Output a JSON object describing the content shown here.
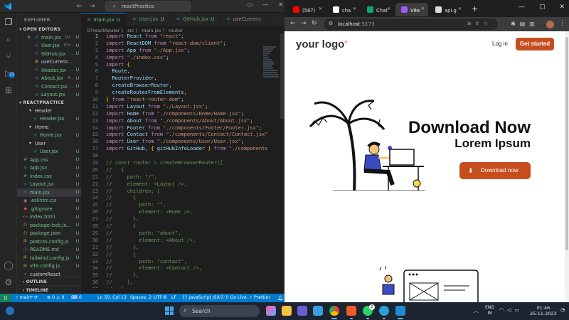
{
  "vscode": {
    "title_search": "reactPractice",
    "nav_back": "←",
    "nav_forward": "→",
    "explorer_label": "EXPLORER",
    "open_editors_label": "OPEN EDITORS",
    "open_editors": [
      {
        "icon": "×",
        "name": "main.jsx",
        "path": "07...",
        "status": "U"
      },
      {
        "icon": "",
        "name": "User.jsx",
        "path": "07r...",
        "status": "U"
      },
      {
        "icon": "",
        "name": "GitHub.jsx",
        "path": "...",
        "status": "U"
      },
      {
        "icon": "",
        "name": "useCurrencyInfo.j...",
        "path": "",
        "status": ""
      },
      {
        "icon": "",
        "name": "Header.jsx",
        "path": "...",
        "status": "U"
      },
      {
        "icon": "",
        "name": "About.jsx",
        "path": "0...",
        "status": "U"
      },
      {
        "icon": "",
        "name": "Contact.jsx",
        "path": "...",
        "status": "U"
      },
      {
        "icon": "",
        "name": "Layout.jsx",
        "path": "...",
        "status": "U"
      }
    ],
    "project_label": "REACTPRACTICE",
    "tree": [
      {
        "name": "Header",
        "kind": "folder",
        "indent": 2,
        "status": ""
      },
      {
        "name": "Header.jsx",
        "kind": "react",
        "indent": 3,
        "status": "U"
      },
      {
        "name": "Home",
        "kind": "folder",
        "indent": 2,
        "status": ""
      },
      {
        "name": "Home.jsx",
        "kind": "react",
        "indent": 3,
        "status": "U"
      },
      {
        "name": "User",
        "kind": "folder",
        "indent": 2,
        "status": ""
      },
      {
        "name": "User.jsx",
        "kind": "react",
        "indent": 3,
        "status": "U"
      },
      {
        "name": "App.css",
        "kind": "css",
        "indent": 1,
        "status": "U"
      },
      {
        "name": "App.jsx",
        "kind": "react",
        "indent": 1,
        "status": "U"
      },
      {
        "name": "index.css",
        "kind": "css",
        "indent": 1,
        "status": "U"
      },
      {
        "name": "Layout.jsx",
        "kind": "react",
        "indent": 1,
        "status": "U"
      },
      {
        "name": "main.jsx",
        "kind": "react",
        "indent": 1,
        "status": "U",
        "selected": true
      },
      {
        "name": ".eslintrc.cjs",
        "kind": "eslint",
        "indent": 1,
        "status": "U"
      },
      {
        "name": ".gitignore",
        "kind": "git",
        "indent": 1,
        "status": "U"
      },
      {
        "name": "index.html",
        "kind": "html",
        "indent": 1,
        "status": "U"
      },
      {
        "name": "package-lock.js...",
        "kind": "json",
        "indent": 1,
        "status": "U"
      },
      {
        "name": "package.json",
        "kind": "json",
        "indent": 1,
        "status": "U"
      },
      {
        "name": "postcss.config.js",
        "kind": "js",
        "indent": 1,
        "status": "U"
      },
      {
        "name": "README.md",
        "kind": "md",
        "indent": 1,
        "status": "U"
      },
      {
        "name": "tailwind.config.js",
        "kind": "js",
        "indent": 1,
        "status": "U"
      },
      {
        "name": "vite.config.js",
        "kind": "js",
        "indent": 1,
        "status": "U"
      },
      {
        "name": "customReact",
        "kind": "folder-closed",
        "indent": 1,
        "status": ""
      }
    ],
    "outline_label": "OUTLINE",
    "timeline_label": "TIMELINE",
    "activity_badge": "21",
    "tabs": [
      {
        "label": "main.jsx",
        "status": "U",
        "active": true
      },
      {
        "label": "User.jsx",
        "status": "U",
        "active": false
      },
      {
        "label": "GitHub.jsx",
        "status": "U",
        "active": false
      },
      {
        "label": "useCurrenc",
        "status": "",
        "active": false
      }
    ],
    "breadcrumb": "07reactRouter 〉 src 〉 main.jsx 〉 router",
    "code_lines": [
      [
        [
          "k",
          "import "
        ],
        [
          "v",
          "React "
        ],
        [
          "k",
          "from "
        ],
        [
          "s",
          "\"react\""
        ],
        [
          "",
          "; "
        ]
      ],
      [
        [
          "k",
          "import "
        ],
        [
          "v",
          "ReactDOM "
        ],
        [
          "k",
          "from "
        ],
        [
          "s",
          "\"react-dom/client\""
        ],
        [
          "",
          ";"
        ]
      ],
      [
        [
          "k",
          "import "
        ],
        [
          "v",
          "App "
        ],
        [
          "k",
          "from "
        ],
        [
          "s",
          "\"./App.jsx\""
        ],
        [
          "",
          ";"
        ]
      ],
      [
        [
          "k",
          "import "
        ],
        [
          "s",
          "\"./index.css\""
        ],
        [
          "",
          ";"
        ]
      ],
      [
        [
          "k",
          "import "
        ],
        [
          "p",
          "{"
        ]
      ],
      [
        [
          "",
          "  "
        ],
        [
          "v",
          "Route"
        ],
        [
          "",
          ","
        ]
      ],
      [
        [
          "",
          "  "
        ],
        [
          "v",
          "RouterProvider"
        ],
        [
          "",
          ","
        ]
      ],
      [
        [
          "",
          "  "
        ],
        [
          "v",
          "createBrowserRouter"
        ],
        [
          "",
          ","
        ]
      ],
      [
        [
          "",
          "  "
        ],
        [
          "v",
          "createRoutesFromElements"
        ],
        [
          "",
          ","
        ]
      ],
      [
        [
          "p",
          "} "
        ],
        [
          "k",
          "from "
        ],
        [
          "s",
          "\"react-router-dom\""
        ],
        [
          "",
          ";"
        ]
      ],
      [
        [
          "k",
          "import "
        ],
        [
          "v",
          "Layout "
        ],
        [
          "k",
          "from "
        ],
        [
          "s",
          "\"./Layout.jsx\""
        ],
        [
          "",
          ";"
        ]
      ],
      [
        [
          "k",
          "import "
        ],
        [
          "v",
          "Home "
        ],
        [
          "k",
          "from "
        ],
        [
          "s",
          "\"./components/Home/Home.jsx\""
        ],
        [
          "",
          ";"
        ]
      ],
      [
        [
          "k",
          "import "
        ],
        [
          "v",
          "About "
        ],
        [
          "k",
          "from "
        ],
        [
          "s",
          "\"./components/About/About.jsx\""
        ],
        [
          "",
          ";"
        ]
      ],
      [
        [
          "k",
          "import "
        ],
        [
          "v",
          "Footer "
        ],
        [
          "k",
          "from "
        ],
        [
          "s",
          "\"./components/Footer/Footer.jsx\""
        ],
        [
          "",
          ";"
        ]
      ],
      [
        [
          "k",
          "import "
        ],
        [
          "v",
          "Contact "
        ],
        [
          "k",
          "from "
        ],
        [
          "s",
          "\"./components/Contact/Contact.jsx\""
        ]
      ],
      [
        [
          "k",
          "import "
        ],
        [
          "v",
          "User "
        ],
        [
          "k",
          "from "
        ],
        [
          "s",
          "\"./components/User/User.jsx\""
        ],
        [
          "",
          ";"
        ]
      ],
      [
        [
          "k",
          "import "
        ],
        [
          "v",
          "GitHub"
        ],
        [
          "",
          ", "
        ],
        [
          "p",
          "{ "
        ],
        [
          "v",
          "gitHubInfoLoader "
        ],
        [
          "p",
          "} "
        ],
        [
          "k",
          "from "
        ],
        [
          "s",
          "\"./components"
        ]
      ],
      [
        [
          "",
          ""
        ]
      ],
      [
        [
          "c",
          "// const router = createBrowserRouter(["
        ]
      ],
      [
        [
          "c",
          "//   {"
        ]
      ],
      [
        [
          "c",
          "//     path: \"/\","
        ]
      ],
      [
        [
          "c",
          "//     element: <Layout />,"
        ]
      ],
      [
        [
          "c",
          "//     children: ["
        ]
      ],
      [
        [
          "c",
          "//       {"
        ]
      ],
      [
        [
          "c",
          "//         path: \"\","
        ]
      ],
      [
        [
          "c",
          "//         element: <Home />,"
        ]
      ],
      [
        [
          "c",
          "//       },"
        ]
      ],
      [
        [
          "c",
          "//       {"
        ]
      ],
      [
        [
          "c",
          "//         path: \"about\","
        ]
      ],
      [
        [
          "c",
          "//         element: <About />,"
        ]
      ],
      [
        [
          "c",
          "//       },"
        ]
      ],
      [
        [
          "c",
          "//       {"
        ]
      ],
      [
        [
          "c",
          "//         path: \"contact\","
        ]
      ],
      [
        [
          "c",
          "//         element: <Contact />,"
        ]
      ],
      [
        [
          "c",
          "//       },"
        ]
      ],
      [
        [
          "c",
          "//     ],"
        ]
      ],
      [
        [
          "c",
          "//   },"
        ]
      ]
    ],
    "status": {
      "branch": "main*",
      "sync": "⟳",
      "problems": "⊗ 0 ⚠ 0",
      "ports": "⌨ 0",
      "position": "Ln 50, Col 13",
      "spaces": "Spaces: 2",
      "encoding": "UTF-8",
      "eol": "LF",
      "language": "{} JavaScript JSX",
      "golive": "((·)) Go Live",
      "prettier": "✓ Prettier"
    }
  },
  "chrome": {
    "tabs": [
      {
        "label": "(587)",
        "color": "#ff0000"
      },
      {
        "label": "cha",
        "color": "#ffffff"
      },
      {
        "label": "Chat",
        "color": "#10a37f"
      },
      {
        "label": "Vite",
        "color": "#a259ff",
        "active": true
      },
      {
        "label": "api.g",
        "color": "#dddddd"
      }
    ],
    "new_tab": "+",
    "url_host": "localhost",
    "url_port": ":5173"
  },
  "site": {
    "logo_text": "your logo",
    "logo_mark": "®",
    "login": "Log in",
    "get_started": "Get started",
    "hero_title": "Download Now",
    "hero_subtitle": "Lorem Ipsum",
    "download_button": "Download now"
  },
  "taskbar": {
    "search_placeholder": "Search",
    "lang_top": "ENG",
    "lang_bottom": "IN",
    "time": "01:46",
    "date": "25-11-2023",
    "whatsapp_badge": "2"
  },
  "colors": {
    "accent": "#c64e1e",
    "vscode_status": "#007acc",
    "git_untracked": "#73c991"
  }
}
